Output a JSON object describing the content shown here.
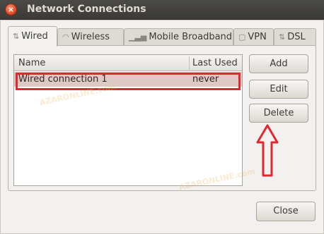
{
  "window": {
    "title": "Network Connections"
  },
  "tabs": [
    {
      "label": "Wired",
      "icon": "network-wired-icon",
      "active": true
    },
    {
      "label": "Wireless",
      "icon": "wireless-icon",
      "active": false
    },
    {
      "label": "Mobile Broadband",
      "icon": "mobile-broadband-icon",
      "active": false
    },
    {
      "label": "VPN",
      "icon": "vpn-lock-icon",
      "active": false
    },
    {
      "label": "DSL",
      "icon": "dsl-icon",
      "active": false
    }
  ],
  "list": {
    "columns": [
      "Name",
      "Last Used"
    ],
    "rows": [
      {
        "name": "Wired connection 1",
        "last_used": "never"
      }
    ]
  },
  "buttons": {
    "add": "Add",
    "edit": "Edit",
    "delete": "Delete",
    "close": "Close"
  },
  "annotation": {
    "highlight_color": "#e3272e",
    "arrow_color": "#e3272e"
  },
  "watermark": {
    "domain": "AZARONLINE.com"
  }
}
